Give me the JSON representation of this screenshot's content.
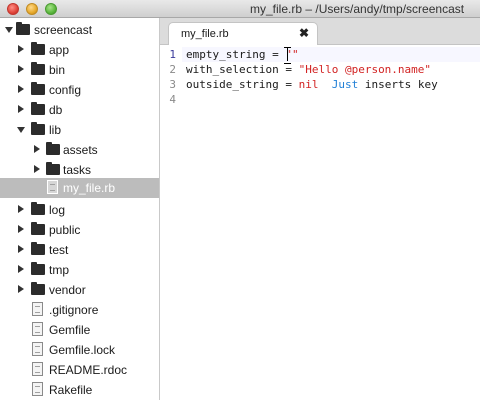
{
  "window": {
    "title": "my_file.rb – /Users/andy/tmp/screencast"
  },
  "sidebar": {
    "root": {
      "label": "screencast",
      "expanded": true
    },
    "items": [
      {
        "label": "app",
        "kind": "folder",
        "expanded": false
      },
      {
        "label": "bin",
        "kind": "folder",
        "expanded": false
      },
      {
        "label": "config",
        "kind": "folder",
        "expanded": false
      },
      {
        "label": "db",
        "kind": "folder",
        "expanded": false
      },
      {
        "label": "lib",
        "kind": "folder",
        "expanded": true
      },
      {
        "label": "assets",
        "kind": "folder",
        "expanded": false
      },
      {
        "label": "tasks",
        "kind": "folder",
        "expanded": false
      },
      {
        "label": "my_file.rb",
        "kind": "file",
        "selected": true
      },
      {
        "label": "log",
        "kind": "folder",
        "expanded": false
      },
      {
        "label": "public",
        "kind": "folder",
        "expanded": false
      },
      {
        "label": "test",
        "kind": "folder",
        "expanded": false
      },
      {
        "label": "tmp",
        "kind": "folder",
        "expanded": false
      },
      {
        "label": "vendor",
        "kind": "folder",
        "expanded": false
      },
      {
        "label": ".gitignore",
        "kind": "file"
      },
      {
        "label": "Gemfile",
        "kind": "file"
      },
      {
        "label": "Gemfile.lock",
        "kind": "file"
      },
      {
        "label": "README.rdoc",
        "kind": "file"
      },
      {
        "label": "Rakefile",
        "kind": "file"
      }
    ]
  },
  "tabs": [
    {
      "label": "my_file.rb",
      "active": true,
      "close_glyph": "✖"
    }
  ],
  "editor": {
    "line_numbers": [
      "1",
      "2",
      "3",
      "4"
    ],
    "current_line": "1",
    "lines": {
      "l1": {
        "ident": "empty_string",
        "op": " = ",
        "str": "\"\""
      },
      "l2": {
        "ident": "with_selection",
        "op": " = ",
        "str": "\"Hello @person.name\""
      },
      "l3": {
        "ident": "outside_string",
        "op": " = ",
        "nil": "nil",
        "note": "Just inserts key",
        "note_kw": "Just"
      }
    }
  },
  "colors": {
    "string": "#d22323",
    "keyword_blue": "#1f7fd6",
    "selection_row": "#bcbcbc"
  }
}
